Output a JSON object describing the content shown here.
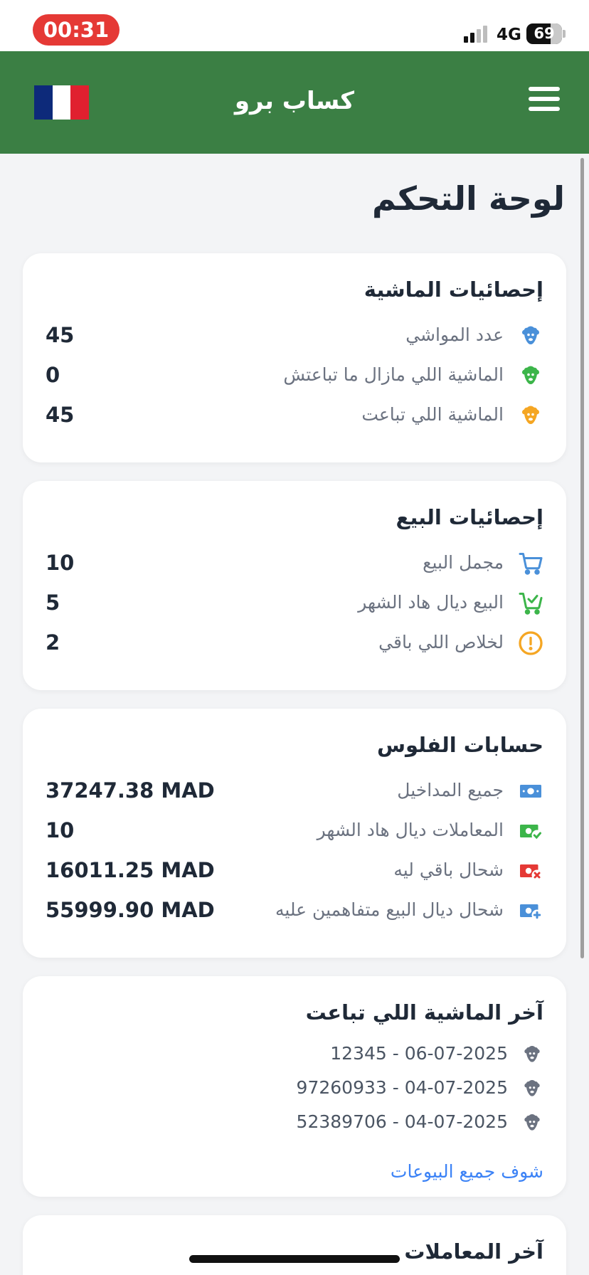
{
  "status_bar": {
    "time": "00:31",
    "network": "4G",
    "battery": "69"
  },
  "app_bar": {
    "title": "كساب برو",
    "flag_icon": "france-flag-icon",
    "menu_icon": "hamburger-menu-icon"
  },
  "page": {
    "title": "لوحة التحكم"
  },
  "livestock_stats": {
    "title": "إحصائيات الماشية",
    "rows": [
      {
        "label": "عدد المواشي",
        "value": "45",
        "icon": "sheep-icon",
        "color": "#4a90d9"
      },
      {
        "label": "الماشية اللي مازال ما تباعتش",
        "value": "0",
        "icon": "sheep-icon",
        "color": "#3cb54a"
      },
      {
        "label": "الماشية اللي تباعت",
        "value": "45",
        "icon": "sheep-icon",
        "color": "#f5a623"
      }
    ]
  },
  "sales_stats": {
    "title": "إحصائيات البيع",
    "rows": [
      {
        "label": "مجمل البيع",
        "value": "10",
        "icon": "cart-icon",
        "color": "#4a90d9"
      },
      {
        "label": "البيع ديال هاد الشهر",
        "value": "5",
        "icon": "cart-check-icon",
        "color": "#3cb54a"
      },
      {
        "label": "لخلاص اللي باقي",
        "value": "2",
        "icon": "alert-circle-icon",
        "color": "#f5a623"
      }
    ]
  },
  "money_accounts": {
    "title": "حسابات الفلوس",
    "rows": [
      {
        "label": "جميع المداخيل",
        "value": "37247.38 MAD",
        "icon": "cash-icon",
        "color": "#4a90d9"
      },
      {
        "label": "المعاملات ديال هاد الشهر",
        "value": "10",
        "icon": "cash-check-icon",
        "color": "#3cb54a"
      },
      {
        "label": "شحال باقي ليه",
        "value": "16011.25 MAD",
        "icon": "cash-x-icon",
        "color": "#e53935"
      },
      {
        "label": "شحال ديال البيع متفاهمين عليه",
        "value": "55999.90 MAD",
        "icon": "cash-plus-icon",
        "color": "#4a90d9"
      }
    ]
  },
  "recent_sales": {
    "title": "آخر الماشية اللي تباعت",
    "items": [
      {
        "text": "12345 - 06-07-2025",
        "icon": "sheep-icon"
      },
      {
        "text": "97260933 - 04-07-2025",
        "icon": "sheep-icon"
      },
      {
        "text": "52389706 - 04-07-2025",
        "icon": "sheep-icon"
      }
    ],
    "link": "شوف جميع البيوعات"
  },
  "recent_transactions": {
    "title": "آخر المعاملات"
  },
  "colors": {
    "app_bar": "#3b7f44",
    "background": "#f3f4f6",
    "link": "#3b82f6",
    "status_time": "#e53935"
  }
}
